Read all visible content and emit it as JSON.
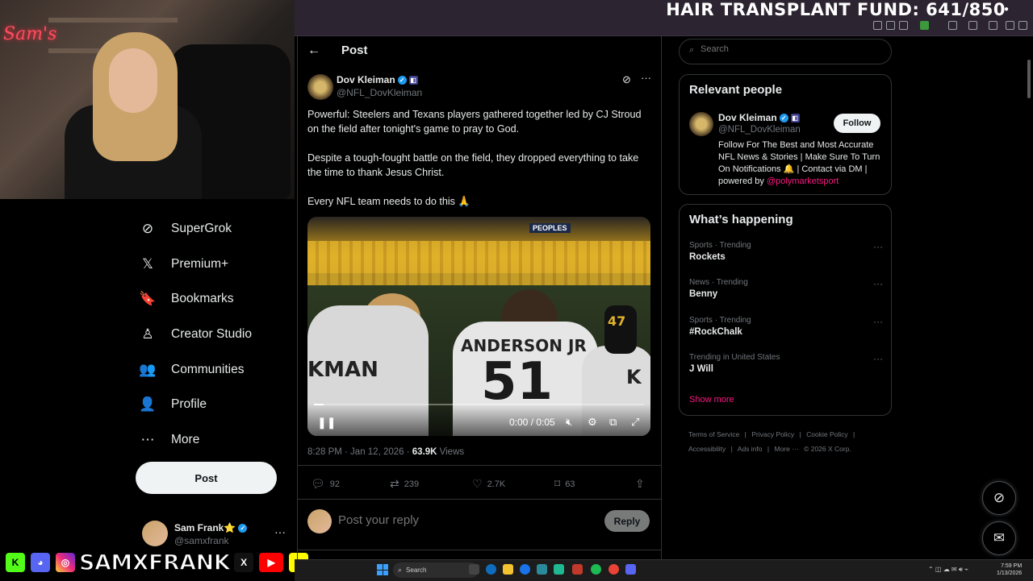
{
  "stream": {
    "banner": "HAIR TRANSPLANT FUND: 641/850",
    "neon_sign": "Sam's",
    "social_handle": "SAMXFRANK"
  },
  "nav": {
    "items": [
      {
        "label": "SuperGrok",
        "icon": "grok-icon",
        "glyph": "⊘"
      },
      {
        "label": "Premium+",
        "icon": "x-logo-icon",
        "glyph": "𝕏"
      },
      {
        "label": "Bookmarks",
        "icon": "bookmark-icon",
        "glyph": "🔖"
      },
      {
        "label": "Creator Studio",
        "icon": "creator-studio-icon",
        "glyph": "♙"
      },
      {
        "label": "Communities",
        "icon": "communities-icon",
        "glyph": "👥"
      },
      {
        "label": "Profile",
        "icon": "profile-icon",
        "glyph": "👤"
      },
      {
        "label": "More",
        "icon": "more-circle-icon",
        "glyph": "⋯"
      }
    ],
    "post_button": "Post",
    "account": {
      "name": "Sam Frank⭐",
      "handle": "@samxfrank",
      "more": "···"
    }
  },
  "post": {
    "header_title": "Post",
    "author": {
      "name": "Dov Kleiman",
      "handle": "@NFL_DovKleiman"
    },
    "paragraphs": [
      "Powerful: Steelers and Texans players gathered together led by CJ Stroud on the field after tonight's game to pray to God.",
      "Despite a tough-fought battle on the field, they dropped everything to take the time to thank Jesus Christ.",
      "Every NFL team needs to do this 🙏"
    ],
    "video": {
      "time": "0:00 / 0:05",
      "progress": 0.03,
      "stadium_sign": "PEOPLES",
      "jersey_name": "ANDERSON JR",
      "jersey_number": "51",
      "jersey_left": "KMAN",
      "jersey_right": "K",
      "jersey_side": "47"
    },
    "meta": {
      "time": "8:28 PM · Jan 12, 2026 · ",
      "views": "63.9K",
      "views_label": " Views"
    },
    "actions": {
      "replies": "92",
      "reposts": "239",
      "likes": "2.7K",
      "bookmarks": "63"
    },
    "reply_placeholder": "Post your reply",
    "reply_button": "Reply"
  },
  "right": {
    "search_placeholder": "Search",
    "relevant": {
      "title": "Relevant people",
      "name": "Dov Kleiman",
      "handle": "@NFL_DovKleiman",
      "follow": "Follow",
      "bio": "Follow For The Best and Most Accurate NFL News & Stories | Make Sure To Turn On Notifications 🔔 | Contact via DM | powered by ",
      "bio_link": "@polymarketsport"
    },
    "happening": {
      "title": "What’s happening",
      "trends": [
        {
          "category": "Sports · Trending",
          "name": "Rockets"
        },
        {
          "category": "News · Trending",
          "name": "Benny"
        },
        {
          "category": "Sports · Trending",
          "name": "#RockChalk"
        },
        {
          "category": "Trending in United States",
          "name": "J Will"
        }
      ],
      "show_more": "Show more"
    },
    "footer": [
      "Terms of Service",
      "|",
      "Privacy Policy",
      "|",
      "Cookie Policy",
      "|",
      "Accessibility",
      "|",
      "Ads info",
      "|",
      "More ···",
      "© 2026 X Corp."
    ]
  },
  "taskbar": {
    "search": "Search",
    "time": "7:59 PM",
    "date": "1/13/2026"
  }
}
